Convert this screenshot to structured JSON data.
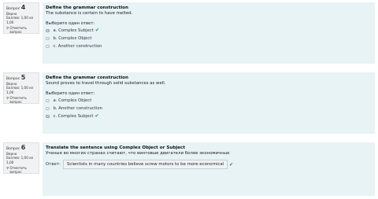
{
  "q4": {
    "label": "Вопрос",
    "num": "4",
    "status": "Верно",
    "score": "Баллов: 1,00 из 1,00",
    "flag": "Отметить вопрос",
    "title": "Define the grammar construction",
    "text": "The substance is certain to have melted.",
    "prompt": "Выберите один ответ:",
    "options": [
      {
        "label": "a. Complex Subject",
        "check": "✔"
      },
      {
        "label": "b. Complex Object"
      },
      {
        "label": "c. Another construction"
      }
    ]
  },
  "q5": {
    "label": "Вопрос",
    "num": "5",
    "status": "Верно",
    "score": "Баллов: 1,00 из 1,00",
    "flag": "Отметить вопрос",
    "title": "Define the grammar construction",
    "text": "Sound proves to travel through solid substances as well.",
    "prompt": "Выберите один ответ:",
    "options": [
      {
        "label": "a. Complex Object"
      },
      {
        "label": "b. Another construction"
      },
      {
        "label": "c. Complex Subject",
        "check": "✔"
      }
    ]
  },
  "q6": {
    "label": "Вопрос",
    "num": "6",
    "status": "Верно",
    "score": "Баллов: 1,00 из 1,00",
    "flag": "Отметить вопрос",
    "title": "Translate the sentence using Complex Object or Subject",
    "text": "Ученые во многих странах считают, что винтовые двигатели более экономичные",
    "answer_label": "Ответ:",
    "answer_value": "Scientists in many countries believe screw motors to be more economical",
    "check": "✔"
  }
}
